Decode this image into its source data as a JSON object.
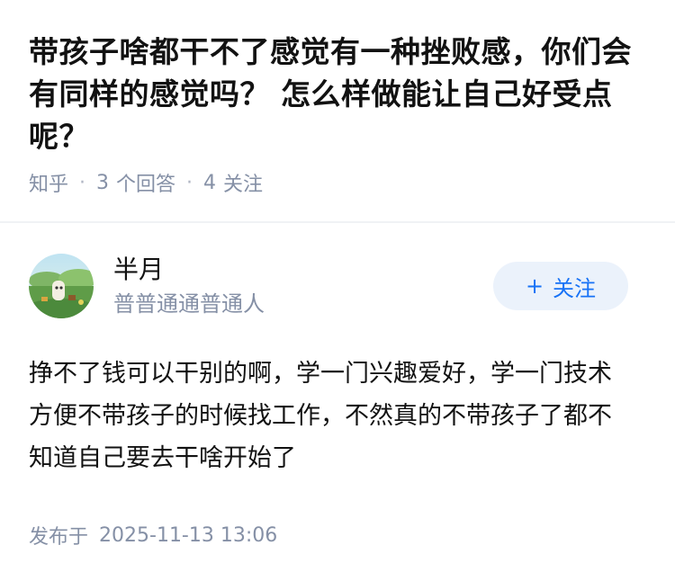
{
  "question": {
    "title": "带孩子啥都干不了感觉有一种挫败感，你们会有同样的感觉吗？ 怎么样做能让自己好受点呢？",
    "source": "知乎",
    "separator": "·",
    "answer_count": "3",
    "answer_label": "个回答",
    "follower_count": "4",
    "follower_label": "关注"
  },
  "answer": {
    "author_name": "半月",
    "author_bio": "普普通通普通人",
    "avatar_icon": "avatar-image-icon",
    "follow_plus": "+",
    "follow_label": "关注",
    "content": "挣不了钱可以干别的啊，学一门兴趣爱好，学一门技术方便不带孩子的时候找工作，不然真的不带孩子了都不知道自己要去干啥开始了",
    "publish_label": "发布于",
    "publish_time": "2025-11-13 13:06"
  },
  "colors": {
    "accent": "#1772f6",
    "follow_bg": "#ebf2fb",
    "meta_gray": "#8590a6"
  }
}
